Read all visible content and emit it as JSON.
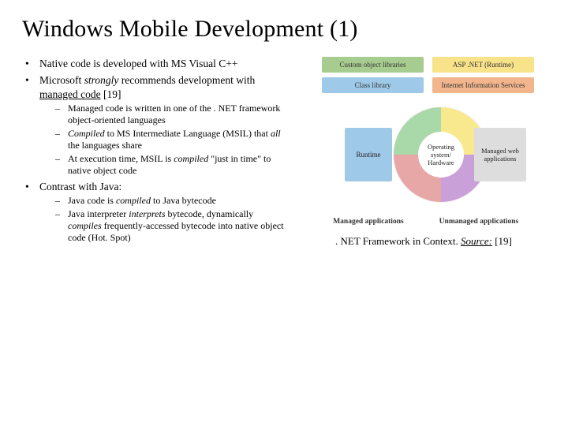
{
  "title": "Windows Mobile Development (1)",
  "bullets": {
    "b1": "Native code is developed with MS Visual C++",
    "b2_pre": "Microsoft ",
    "b2_em": "strongly",
    "b2_mid": " recommends development with ",
    "b2_u": "managed code",
    "b2_post": " [19]",
    "s1": "Managed code is written in one of the . NET framework object-oriented languages",
    "s2_em1": "Compiled",
    "s2_mid": " to MS Intermediate Language (MSIL) that ",
    "s2_em2": "all",
    "s2_post": " the languages share",
    "s3_pre": "At execution time, MSIL is ",
    "s3_em": "compiled",
    "s3_post": " \"just in time\" to native object code",
    "b3": "Contrast with Java:",
    "s4_pre": "Java code is ",
    "s4_em": "compiled",
    "s4_post": " to Java bytecode",
    "s5_pre": "Java interpreter ",
    "s5_em1": "interprets",
    "s5_mid": " bytecode, dynamically ",
    "s5_em2": "compiles",
    "s5_post": " frequently-accessed bytecode into native object code (Hot. Spot)"
  },
  "diagram": {
    "custom": "Custom object libraries",
    "asp": "ASP .NET (Runtime)",
    "class": "Class library",
    "iis": "Internet Information Services",
    "runtime": "Runtime",
    "mweb": "Managed web applications",
    "os": "Operating system/ Hardware",
    "legend_left": "Managed applications",
    "legend_right": "Unmanaged applications"
  },
  "caption": {
    "text": ". NET Framework in Context. ",
    "src_label": "Source:",
    "src_ref": " [19]"
  }
}
